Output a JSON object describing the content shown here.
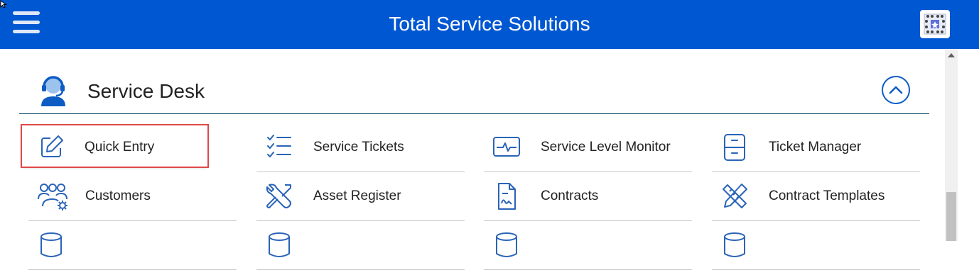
{
  "header": {
    "title": "Total Service Solutions",
    "menu_icon": "hamburger-menu-icon",
    "logo_icon": "app-logo-icon",
    "accent": "#0057d2"
  },
  "section": {
    "title": "Service Desk",
    "icon": "headset-agent-icon",
    "collapse_icon": "chevron-up-icon"
  },
  "tiles": [
    {
      "label": "Quick Entry",
      "icon": "edit-icon",
      "highlighted": true
    },
    {
      "label": "Service Tickets",
      "icon": "checklist-icon"
    },
    {
      "label": "Service Level Monitor",
      "icon": "monitor-pulse-icon"
    },
    {
      "label": "Ticket Manager",
      "icon": "cabinet-icon"
    },
    {
      "label": "Customers",
      "icon": "users-gear-icon"
    },
    {
      "label": "Asset Register",
      "icon": "tools-icon"
    },
    {
      "label": "Contracts",
      "icon": "document-icon"
    },
    {
      "label": "Contract Templates",
      "icon": "pencil-ruler-icon"
    }
  ]
}
